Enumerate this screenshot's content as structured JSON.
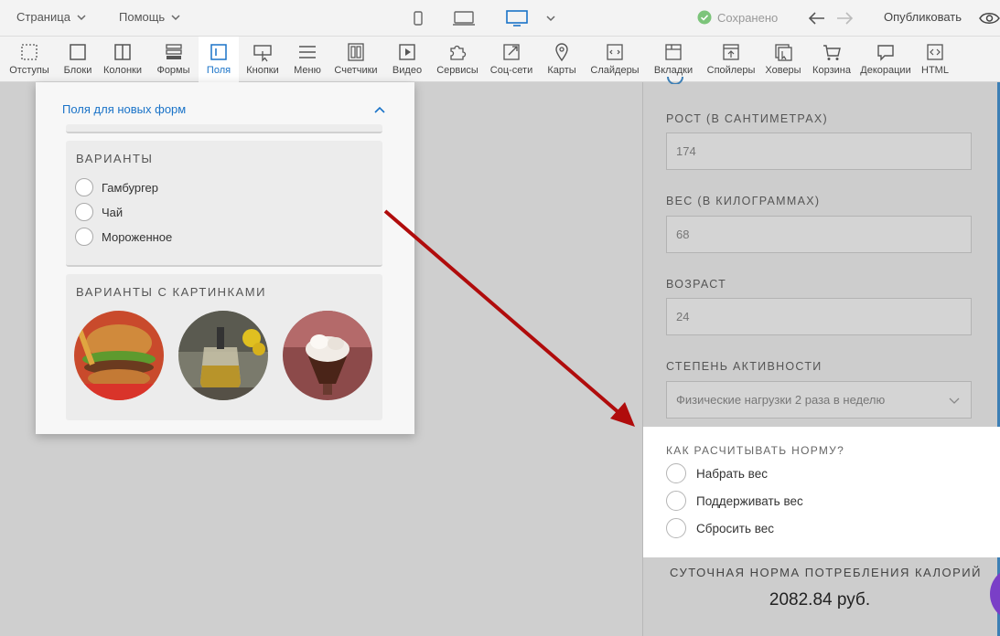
{
  "topbar": {
    "page_menu": "Страница",
    "help_menu": "Помощь",
    "saved_status": "Сохранено",
    "publish_label": "Опубликовать"
  },
  "toolbar": {
    "items": [
      {
        "label": "Отступы",
        "icon": "padding-icon"
      },
      {
        "label": "Блоки",
        "icon": "block-icon"
      },
      {
        "label": "Колонки",
        "icon": "columns-icon"
      },
      {
        "label": "Формы",
        "icon": "forms-icon"
      },
      {
        "label": "Поля",
        "icon": "field-icon",
        "active": true
      },
      {
        "label": "Кнопки",
        "icon": "button-icon"
      },
      {
        "label": "Меню",
        "icon": "menu-icon"
      },
      {
        "label": "Счетчики",
        "icon": "counter-icon"
      },
      {
        "label": "Видео",
        "icon": "video-icon"
      },
      {
        "label": "Сервисы",
        "icon": "puzzle-icon"
      },
      {
        "label": "Соц-сети",
        "icon": "share-icon"
      },
      {
        "label": "Карты",
        "icon": "map-pin-icon"
      },
      {
        "label": "Слайдеры",
        "icon": "slider-icon"
      },
      {
        "label": "Вкладки",
        "icon": "tabs-icon"
      },
      {
        "label": "Спойлеры",
        "icon": "spoiler-icon"
      },
      {
        "label": "Ховеры",
        "icon": "hover-icon"
      },
      {
        "label": "Корзина",
        "icon": "cart-icon"
      },
      {
        "label": "Декорации",
        "icon": "speech-bubble-icon"
      },
      {
        "label": "HTML",
        "icon": "code-icon"
      }
    ]
  },
  "panel": {
    "header": "Поля для новых форм",
    "variants_title": "ВАРИАНТЫ",
    "variants": [
      "Гамбургер",
      "Чай",
      "Мороженное"
    ],
    "picture_variants_title": "ВАРИАНТЫ С КАРТИНКАМИ"
  },
  "form": {
    "height_label": "РОСТ (В САНТИМЕТРАХ)",
    "height_value": "174",
    "weight_label": "ВЕС (В КИЛОГРАММАХ)",
    "weight_value": "68",
    "age_label": "ВОЗРАСТ",
    "age_value": "24",
    "activity_label": "СТЕПЕНЬ АКТИВНОСТИ",
    "activity_value": "Физические нагрузки 2 раза в неделю",
    "norm_title": "КАК РАСЧИТЫВАТЬ НОРМУ?",
    "norm_options": [
      "Набрать вес",
      "Поддерживать вес",
      "Сбросить вес"
    ],
    "result_label": "СУТОЧНАЯ НОРМА ПОТРЕБЛЕНИЯ КАЛОРИЙ",
    "result_value": "2082.84 руб."
  },
  "colors": {
    "accent": "#1a73c8",
    "saved_green": "#7cc47a",
    "arrow_red": "#b00c0c",
    "fab_purple": "#7a3fc7"
  }
}
